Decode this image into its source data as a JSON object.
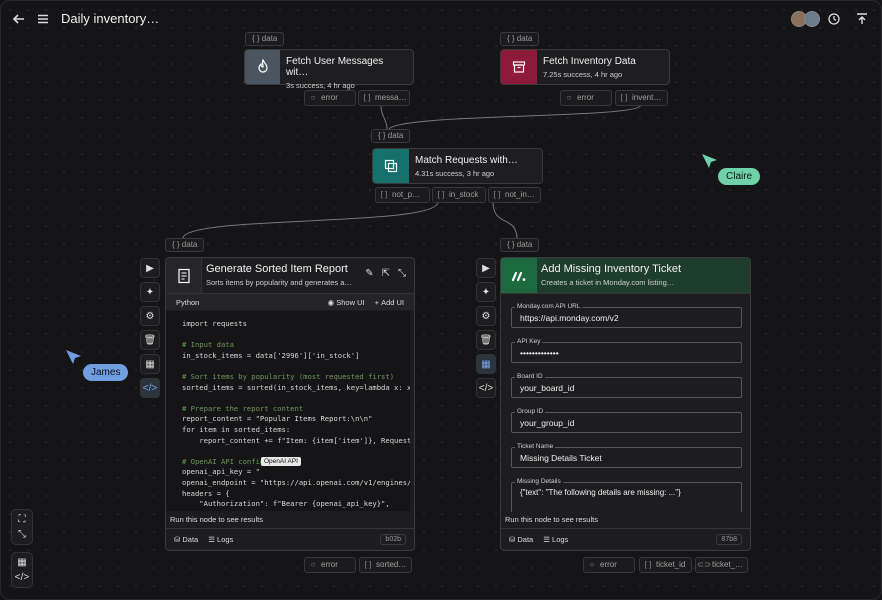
{
  "header": {
    "back_icon": "arrow-left-icon",
    "menu_icon": "hamburger-icon",
    "title": "Daily inventory…",
    "history_icon": "history-icon",
    "publish_icon": "upload-icon"
  },
  "data_label": "{ } data",
  "nodes": {
    "fetch_user": {
      "title": "Fetch User Messages wit…",
      "status": "3s success, 4 hr ago",
      "icon": "fire-icon",
      "color": "#4a5560",
      "ports": [
        {
          "pre": "○",
          "label": "error"
        },
        {
          "pre": "[ ]",
          "label": "messa…"
        }
      ]
    },
    "fetch_inv": {
      "title": "Fetch Inventory Data",
      "status": "7.25s success, 4 hr ago",
      "icon": "archive-icon",
      "color": "#8e1a3a",
      "ports": [
        {
          "pre": "○",
          "label": "error"
        },
        {
          "pre": "[ ]",
          "label": "invent…"
        }
      ]
    },
    "match": {
      "title": "Match Requests with…",
      "status": "4.31s success, 3 hr ago",
      "icon": "merge-icon",
      "color": "#15706b",
      "ports": [
        {
          "pre": "[ ]",
          "label": "not_p…"
        },
        {
          "pre": "[ ]",
          "label": "in_stock"
        },
        {
          "pre": "[ ]",
          "label": "not_in…"
        }
      ]
    }
  },
  "report": {
    "title": "Generate Sorted Item Report",
    "subtitle": "Sorts items by popularity and generates a…",
    "icon": "document-icon",
    "lang": "Python",
    "show_ui": "Show UI",
    "add_ui": "Add UI",
    "code": [
      "import requests",
      "",
      "# Input data",
      "in_stock_items = data['2996']['in_stock']",
      "",
      "# Sort items by popularity (most requested first)",
      "sorted_items = sorted(in_stock_items, key=lambda x: x",
      "",
      "# Prepare the report content",
      "report_content = \"Popular Items Report:\\n\\n\"",
      "for item in sorted_items:",
      "    report_content += f\"Item: {item['item']}, Requeste",
      "",
      "# OpenAI API configuration",
      "openai_api_key = \"",
      "openai_endpoint = \"https://api.openai.com/v1/engines/c",
      "headers = {",
      "    \"Authorization\": f\"Bearer {openai_api_key}\","
    ],
    "secret_badge": "OpenAI API",
    "run_hint": "Run this node to see results",
    "data_btn": "Data",
    "logs_btn": "Logs",
    "hash": "b02b",
    "ports": [
      {
        "pre": "○",
        "label": "error"
      },
      {
        "pre": "[ ]",
        "label": "sorted…"
      }
    ]
  },
  "ticket": {
    "title": "Add Missing Inventory Ticket",
    "subtitle": "Creates a ticket in Monday.com listing…",
    "icon": "monday-icon",
    "fields": [
      {
        "label": "Monday.com API URL",
        "value": "https://api.monday.com/v2"
      },
      {
        "label": "API Key",
        "value": "•••••••••••••"
      },
      {
        "label": "Board ID",
        "value": "your_board_id"
      },
      {
        "label": "Group ID",
        "value": "your_group_id"
      },
      {
        "label": "Ticket Name",
        "value": "Missing Details Ticket"
      },
      {
        "label": "Missing Details",
        "value": "{\"text\": \"The following details are missing: ...\"}"
      }
    ],
    "run_hint": "Run this node to see results",
    "data_btn": "Data",
    "logs_btn": "Logs",
    "hash": "87b8",
    "ports": [
      {
        "pre": "○",
        "label": "error"
      },
      {
        "pre": "[ ]",
        "label": "ticket_id"
      },
      {
        "pre": "⊂⊃",
        "label": "ticket_…"
      }
    ]
  },
  "cursors": [
    {
      "name": "Claire",
      "color": "#6fd1a8"
    },
    {
      "name": "James",
      "color": "#6f9fe0"
    }
  ],
  "colors": {
    "accent_teal": "#15706b",
    "monday_green": "#1d5a3a"
  }
}
